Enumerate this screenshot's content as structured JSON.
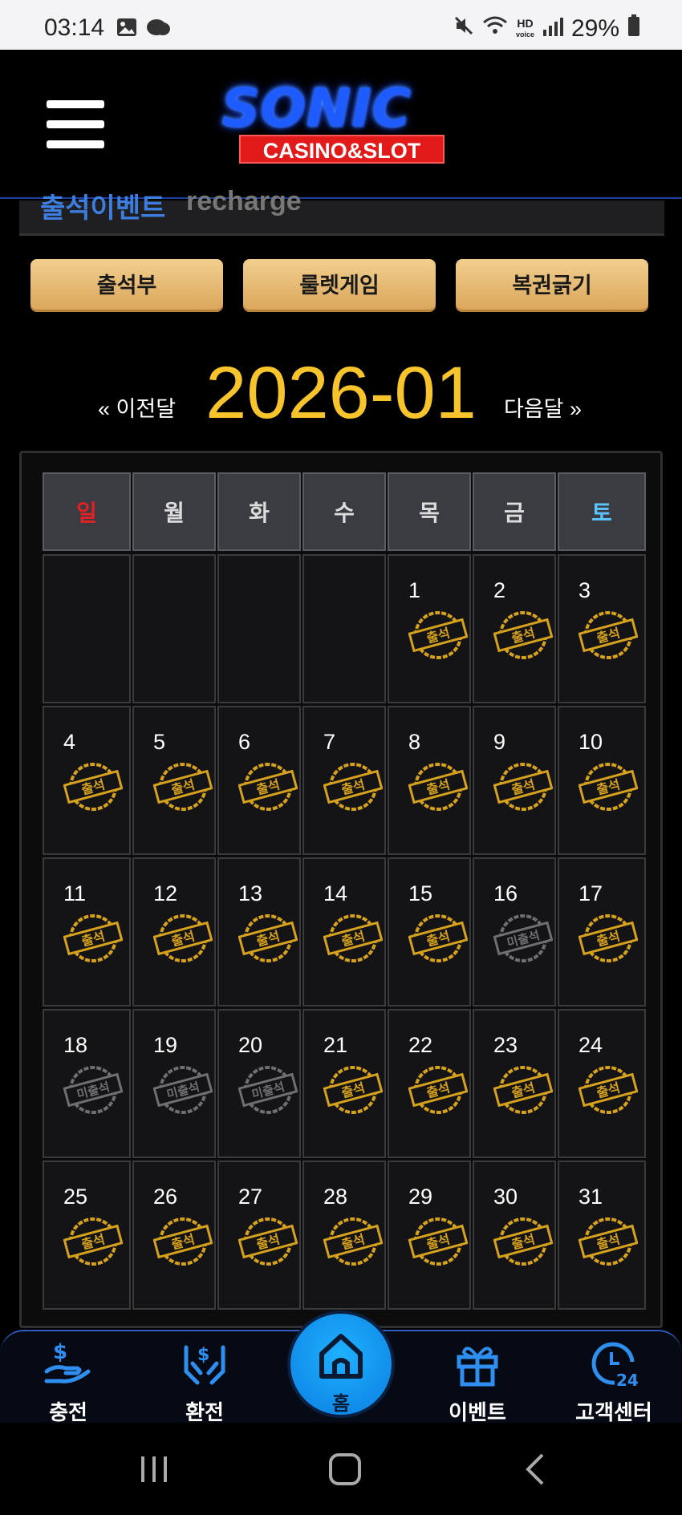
{
  "status_bar": {
    "time": "03:14",
    "battery": "29%",
    "hd_label": "HD",
    "voice_label": "voice"
  },
  "header": {
    "logo_main": "SONIC",
    "logo_sub": "CASINO&SLOT"
  },
  "scrolled_card": {
    "title_part": "출석이벤트",
    "title_faded": "recharge"
  },
  "tabs": [
    {
      "label": "출석부"
    },
    {
      "label": "룰렛게임"
    },
    {
      "label": "복권긁기"
    }
  ],
  "month_nav": {
    "prev": "« 이전달",
    "title": "2026-01",
    "next": "다음달 »"
  },
  "calendar": {
    "weekdays": [
      "일",
      "월",
      "화",
      "수",
      "목",
      "금",
      "토"
    ],
    "weeks": [
      [
        null,
        null,
        null,
        null,
        {
          "day": "1",
          "stamp": "출석"
        },
        {
          "day": "2",
          "stamp": "출석"
        },
        {
          "day": "3",
          "stamp": "출석"
        }
      ],
      [
        {
          "day": "4",
          "stamp": "출석"
        },
        {
          "day": "5",
          "stamp": "출석"
        },
        {
          "day": "6",
          "stamp": "출석"
        },
        {
          "day": "7",
          "stamp": "출석"
        },
        {
          "day": "8",
          "stamp": "출석"
        },
        {
          "day": "9",
          "stamp": "출석"
        },
        {
          "day": "10",
          "stamp": "출석"
        }
      ],
      [
        {
          "day": "11",
          "stamp": "출석"
        },
        {
          "day": "12",
          "stamp": "출석"
        },
        {
          "day": "13",
          "stamp": "출석"
        },
        {
          "day": "14",
          "stamp": "출석"
        },
        {
          "day": "15",
          "stamp": "출석"
        },
        {
          "day": "16",
          "stamp": "미출석"
        },
        {
          "day": "17",
          "stamp": "출석"
        }
      ],
      [
        {
          "day": "18",
          "stamp": "미출석"
        },
        {
          "day": "19",
          "stamp": "미출석"
        },
        {
          "day": "20",
          "stamp": "미출석"
        },
        {
          "day": "21",
          "stamp": "출석"
        },
        {
          "day": "22",
          "stamp": "출석"
        },
        {
          "day": "23",
          "stamp": "출석"
        },
        {
          "day": "24",
          "stamp": "출석"
        }
      ],
      [
        {
          "day": "25",
          "stamp": "출석"
        },
        {
          "day": "26",
          "stamp": "출석"
        },
        {
          "day": "27",
          "stamp": "출석"
        },
        {
          "day": "28",
          "stamp": "출석"
        },
        {
          "day": "29",
          "stamp": "출석"
        },
        {
          "day": "30",
          "stamp": "출석"
        },
        {
          "day": "31",
          "stamp": "출석"
        }
      ]
    ],
    "colors": {
      "attended": "#d6a21e",
      "missed": "#6f6f73",
      "sunday": "#e22222",
      "saturday": "#5cc4ff"
    }
  },
  "bottom_nav": {
    "items": [
      {
        "label": "충전",
        "icon": "deposit-icon"
      },
      {
        "label": "환전",
        "icon": "withdraw-icon"
      },
      {
        "label": "홈",
        "icon": "home-icon"
      },
      {
        "label": "이벤트",
        "icon": "gift-icon"
      },
      {
        "label": "고객센터",
        "icon": "support-24-icon"
      }
    ]
  }
}
